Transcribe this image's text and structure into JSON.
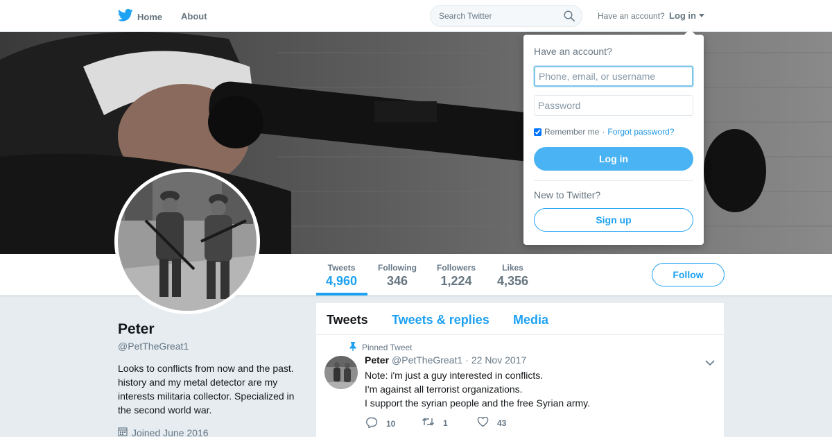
{
  "nav": {
    "home_label": "Home",
    "about_label": "About",
    "search_placeholder": "Search Twitter",
    "have_account": "Have an account?",
    "login_label": "Log in",
    "icons": [
      "twitter-bird-icon",
      "search-icon",
      "chevron-down-icon"
    ]
  },
  "profile": {
    "name": "Peter",
    "handle": "@PetTheGreat1",
    "bio": "Looks to conflicts from now and the past. history and my metal detector are my interests militaria collector. Specialized in the second world war.",
    "joined": "Joined June 2016"
  },
  "stats": [
    {
      "label": "Tweets",
      "value": "4,960"
    },
    {
      "label": "Following",
      "value": "346"
    },
    {
      "label": "Followers",
      "value": "1,224"
    },
    {
      "label": "Likes",
      "value": "4,356"
    }
  ],
  "follow_label": "Follow",
  "tabs": [
    "Tweets",
    "Tweets & replies",
    "Media"
  ],
  "tweet": {
    "pinned_label": "Pinned Tweet",
    "name": "Peter",
    "handle": "@PetTheGreat1",
    "dot": "·",
    "date": "22 Nov 2017",
    "lines": [
      "Note: i'm just a guy interested in conflicts.",
      "I'm against all terrorist organizations.",
      "I support the syrian people and the free Syrian army."
    ],
    "replies": "10",
    "retweets": "1",
    "likes": "43"
  },
  "login_dropdown": {
    "title": "Have an account?",
    "username_placeholder": "Phone, email, or username",
    "password_placeholder": "Password",
    "remember_label": "Remember me",
    "separator": "·",
    "forgot_label": "Forgot password?",
    "login_button": "Log in",
    "new_label": "New to Twitter?",
    "signup_button": "Sign up"
  },
  "colors": {
    "accent": "#1da1f2",
    "background": "#e6ecf0",
    "muted_text": "#657786"
  }
}
